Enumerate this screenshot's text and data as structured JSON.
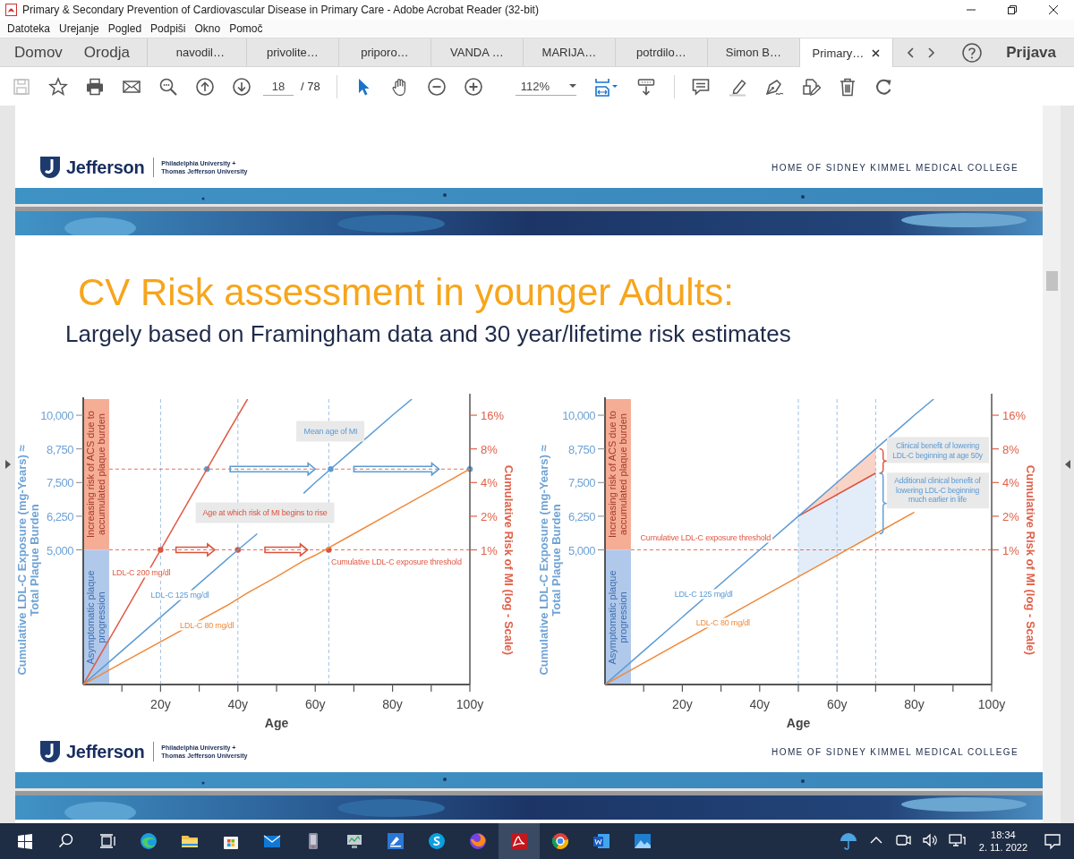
{
  "window": {
    "title": "Primary & Secondary Prevention of Cardiovascular Disease in Primary Care - Adobe Acrobat Reader (32-bit)"
  },
  "menu": [
    "Datoteka",
    "Urejanje",
    "Pogled",
    "Podpiši",
    "Okno",
    "Pomoč"
  ],
  "nav_tabs": [
    "Domov",
    "Orodja"
  ],
  "doc_tabs": [
    {
      "label": "navodil…",
      "selected": false
    },
    {
      "label": "privolite…",
      "selected": false
    },
    {
      "label": "priporo…",
      "selected": false
    },
    {
      "label": "VANDA …",
      "selected": false
    },
    {
      "label": "MARIJA…",
      "selected": false
    },
    {
      "label": "potrdilo…",
      "selected": false
    },
    {
      "label": "Simon B…",
      "selected": false
    },
    {
      "label": "Primary…",
      "selected": true
    }
  ],
  "sign_in": "Prijava",
  "toolbar": {
    "nav_tools": [
      {
        "kind": "save",
        "disabled": true,
        "selected": false
      },
      {
        "kind": "star",
        "disabled": false,
        "selected": false
      },
      {
        "kind": "print",
        "disabled": false,
        "selected": false
      },
      {
        "kind": "mail",
        "disabled": false,
        "selected": false
      },
      {
        "kind": "find",
        "disabled": false,
        "selected": false
      },
      {
        "kind": "up",
        "disabled": false,
        "selected": false
      },
      {
        "kind": "down",
        "disabled": false,
        "selected": false
      }
    ],
    "page": {
      "value": "18",
      "total": "/ 78"
    },
    "view_tools": [
      {
        "kind": "cursor",
        "disabled": false,
        "selected": true
      },
      {
        "kind": "hand",
        "disabled": false,
        "selected": false
      },
      {
        "kind": "minus",
        "disabled": false,
        "selected": false
      },
      {
        "kind": "plus",
        "disabled": false,
        "selected": false
      }
    ],
    "zoom": {
      "value": "112%"
    },
    "layout_tools": [
      {
        "kind": "fit",
        "disabled": false,
        "selected": true
      },
      {
        "kind": "scroll",
        "disabled": false,
        "selected": false
      }
    ],
    "edit_tools": [
      {
        "kind": "comment",
        "disabled": false,
        "selected": false
      },
      {
        "kind": "highlight",
        "disabled": false,
        "selected": false
      },
      {
        "kind": "sign",
        "disabled": false,
        "selected": false
      },
      {
        "kind": "edit",
        "disabled": false,
        "selected": false
      },
      {
        "kind": "trash",
        "disabled": false,
        "selected": false
      },
      {
        "kind": "rotate",
        "disabled": false,
        "selected": false
      }
    ]
  },
  "slide": {
    "header": {
      "logo": "Jefferson",
      "affiliation": [
        "Philadelphia University +",
        "Thomas Jefferson University"
      ],
      "tagline": "HOME OF SIDNEY KIMMEL MEDICAL COLLEGE"
    },
    "title": "CV Risk assessment in younger Adults:",
    "subtitle": "Largely based on Framingham data and 30 year/lifetime risk estimates",
    "charts": [
      {
        "risk_axis": {
          "title": "Cumulative Risk of MI (log - Scale)",
          "ticks": [
            "16%",
            "8%",
            "4%",
            "2%",
            "1%"
          ]
        },
        "chart_data": {
          "type": "line",
          "xlabel": "Age",
          "ylabel": "Cumulative LDL-C Exposure (mg-Years) ≈ Total Plaque Burden",
          "x": [
            0,
            10,
            38,
            42.5,
            45,
            50,
            57,
            60,
            70,
            80,
            85,
            90,
            100
          ],
          "series": [
            {
              "name": "LDL-C 200 mg/dl",
              "color": "#e05a44",
              "values": [
                0,
                2500,
                9500,
                10600,
                null,
                null,
                null,
                null,
                null,
                null,
                null,
                null,
                null
              ]
            },
            {
              "name": "LDL-C 125 mg/dl",
              "color": "#5b9bd5",
              "values": [
                0,
                1250,
                4750,
                5300,
                5600,
                null,
                7100,
                7500,
                8750,
                10000,
                10600,
                null,
                null
              ]
            },
            {
              "name": "LDL-C 80 mg/dl",
              "color": "#f08a3c",
              "values": [
                0,
                800,
                3000,
                3400,
                3600,
                4000,
                4600,
                4800,
                5600,
                6400,
                6800,
                7200,
                8000
              ]
            }
          ],
          "xlim": [
            0,
            100
          ],
          "ylim": [
            0,
            10600
          ],
          "xticks": [
            {
              "value": 20,
              "label": "20y"
            },
            {
              "value": 40,
              "label": "40y"
            },
            {
              "value": 60,
              "label": "60y"
            },
            {
              "value": 80,
              "label": "80y"
            },
            {
              "value": 100,
              "label": "100y"
            }
          ],
          "yticks": [
            {
              "value": 5000,
              "label": "5,000"
            },
            {
              "value": 6250,
              "label": "6,250"
            },
            {
              "value": 7500,
              "label": "7,500"
            },
            {
              "value": 8750,
              "label": "8,750"
            },
            {
              "value": 10000,
              "label": "10,000"
            }
          ],
          "annotations": [
            "Increasing risk of ACS due to accumulated plaque burden",
            "Asymptomatic plaque progression",
            "Mean age of MI",
            "Age at which risk of MI begins to rise",
            "Cumulative LDL-C exposure threshold"
          ]
        }
      },
      {
        "risk_axis": {
          "title": "Cumulative Risk of MI (log - Scale)",
          "ticks": [
            "16%",
            "8%",
            "4%",
            "2%",
            "1%"
          ]
        },
        "chart_data": {
          "type": "line",
          "xlabel": "Age",
          "ylabel": "Cumulative LDL-C Exposure (mg-Years) ≈ Total Plaque Burden",
          "x": [
            0,
            10,
            40,
            50,
            60,
            70,
            80,
            85
          ],
          "series": [
            {
              "name": "LDL-C 125 mg/dl",
              "color": "#5b9bd5",
              "values": [
                0,
                1250,
                5000,
                6250,
                7500,
                8750,
                10000,
                10600
              ]
            },
            {
              "name": "LDL-C 80 mg/dl",
              "color": "#f08a3c",
              "values": [
                0,
                800,
                3200,
                4000,
                4800,
                5600,
                6400,
                null
              ]
            }
          ],
          "xlim": [
            0,
            100
          ],
          "ylim": [
            0,
            10600
          ],
          "xticks": [
            {
              "value": 20,
              "label": "20y"
            },
            {
              "value": 40,
              "label": "40y"
            },
            {
              "value": 60,
              "label": "60y"
            },
            {
              "value": 80,
              "label": "80y"
            },
            {
              "value": 100,
              "label": "100y"
            }
          ],
          "yticks": [
            {
              "value": 5000,
              "label": "5,000"
            },
            {
              "value": 6250,
              "label": "6,250"
            },
            {
              "value": 7500,
              "label": "7,500"
            },
            {
              "value": 8750,
              "label": "8,750"
            },
            {
              "value": 10000,
              "label": "10,000"
            }
          ],
          "annotations": [
            "Increasing risk of ACS due to accumulated plaque burden",
            "Asymptomatic plaque progression",
            "Cumulative LDL-C exposure threshold",
            "Clinical benefit of lowering LDL-C beginning at age 50y",
            "Additional clinical benefit of lowering LDL-C beginning much earlier in life"
          ]
        }
      }
    ]
  },
  "next_page": {
    "header": {
      "logo": "Jefferson",
      "affiliation": [
        "Philadelphia University +",
        "Thomas Jefferson University"
      ],
      "tagline": "HOME OF SIDNEY KIMMEL MEDICAL COLLEGE"
    }
  },
  "taskbar": {
    "apps": [
      {
        "kind": "start",
        "selected": false
      },
      {
        "kind": "search",
        "selected": false
      },
      {
        "kind": "taskview",
        "selected": false
      },
      {
        "kind": "browser",
        "selected": false
      },
      {
        "kind": "folder",
        "selected": false
      },
      {
        "kind": "store",
        "selected": false
      },
      {
        "kind": "mail",
        "selected": false
      },
      {
        "kind": "device",
        "selected": false
      },
      {
        "kind": "monitor",
        "selected": false
      },
      {
        "kind": "scanner",
        "selected": false
      },
      {
        "kind": "chat",
        "selected": false
      },
      {
        "kind": "fox",
        "selected": false
      },
      {
        "kind": "pdf",
        "selected": true
      },
      {
        "kind": "chrome",
        "selected": false
      },
      {
        "kind": "word",
        "selected": false
      },
      {
        "kind": "photos",
        "selected": false
      }
    ],
    "time": "18:34",
    "date": "2. 11. 2022"
  }
}
